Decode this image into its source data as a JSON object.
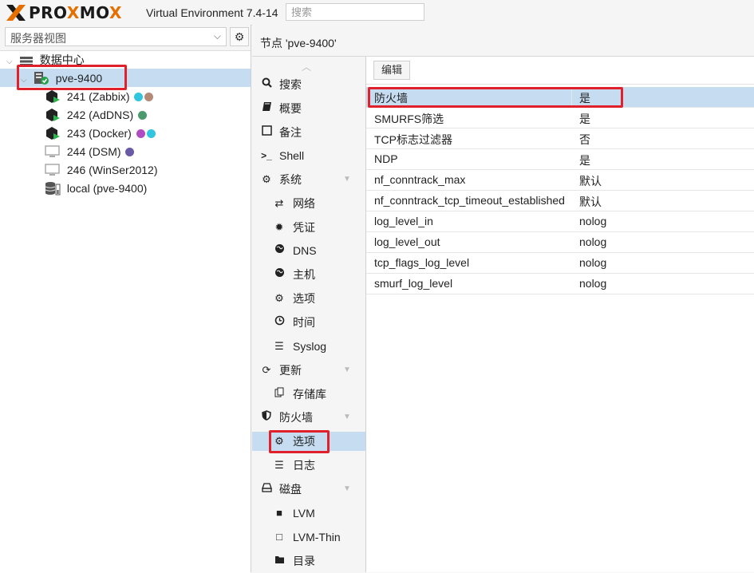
{
  "header": {
    "logo_pro": "PRO",
    "logo_x": "X",
    "logo_mo": "MO",
    "logo_x2": "X",
    "version": "Virtual Environment 7.4-14",
    "search_placeholder": "搜索"
  },
  "left_panel": {
    "view_label": "服务器视图",
    "tree": {
      "datacenter": "数据中心",
      "node": "pve-9400",
      "guests": [
        {
          "label": "241 (Zabbix)",
          "running": true,
          "tags": [
            "#31c5e0",
            "#b38a78"
          ]
        },
        {
          "label": "242 (AdDNS)",
          "running": true,
          "tags": [
            "#4a9a6e"
          ]
        },
        {
          "label": "243 (Docker)",
          "running": true,
          "tags": [
            "#b04cc1",
            "#31c5e0"
          ]
        },
        {
          "label": "244 (DSM)",
          "running": false,
          "tags": [
            "#6a5aa6"
          ]
        },
        {
          "label": "246 (WinSer2012)",
          "running": false,
          "tags": []
        }
      ],
      "storage": "local (pve-9400)"
    }
  },
  "main": {
    "title": "节点 'pve-9400'",
    "nav": [
      {
        "label": "搜索",
        "icon": "search-icon"
      },
      {
        "label": "概要",
        "icon": "book-icon"
      },
      {
        "label": "备注",
        "icon": "note-icon"
      },
      {
        "label": "Shell",
        "icon": "terminal-icon"
      },
      {
        "label": "系统",
        "icon": "cogs-icon"
      },
      {
        "label": "网络",
        "icon": "exchange-icon"
      },
      {
        "label": "凭证",
        "icon": "certificate-icon"
      },
      {
        "label": "DNS",
        "icon": "globe-icon"
      },
      {
        "label": "主机",
        "icon": "globe-icon"
      },
      {
        "label": "选项",
        "icon": "gear-icon"
      },
      {
        "label": "时间",
        "icon": "clock-icon"
      },
      {
        "label": "Syslog",
        "icon": "list-icon"
      },
      {
        "label": "更新",
        "icon": "refresh-icon"
      },
      {
        "label": "存储库",
        "icon": "files-icon"
      },
      {
        "label": "防火墙",
        "icon": "shield-icon"
      },
      {
        "label": "选项",
        "icon": "gear-icon"
      },
      {
        "label": "日志",
        "icon": "list-icon"
      },
      {
        "label": "磁盘",
        "icon": "hdd-icon"
      },
      {
        "label": "LVM",
        "icon": "square-icon"
      },
      {
        "label": "LVM-Thin",
        "icon": "square-outline-icon"
      },
      {
        "label": "目录",
        "icon": "folder-icon"
      }
    ],
    "edit_button": "编辑",
    "properties": [
      {
        "key": "防火墙",
        "value": "是"
      },
      {
        "key": "SMURFS筛选",
        "value": "是"
      },
      {
        "key": "TCP标志过滤器",
        "value": "否"
      },
      {
        "key": "NDP",
        "value": "是"
      },
      {
        "key": "nf_conntrack_max",
        "value": "默认"
      },
      {
        "key": "nf_conntrack_tcp_timeout_established",
        "value": "默认"
      },
      {
        "key": "log_level_in",
        "value": "nolog"
      },
      {
        "key": "log_level_out",
        "value": "nolog"
      },
      {
        "key": "tcp_flags_log_level",
        "value": "nolog"
      },
      {
        "key": "smurf_log_level",
        "value": "nolog"
      }
    ]
  }
}
